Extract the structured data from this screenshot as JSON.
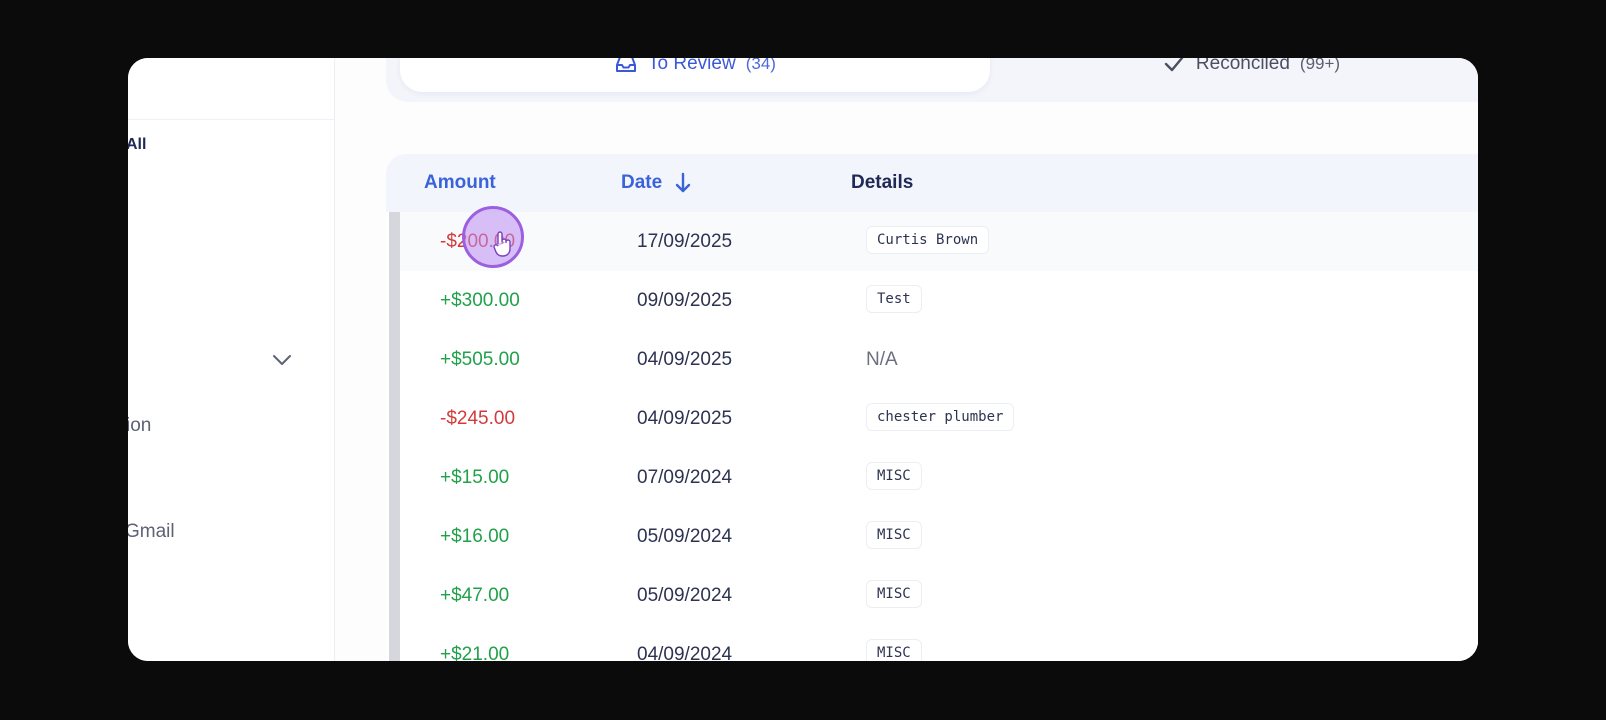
{
  "sidebar": {
    "all_label": "All",
    "item_ion": "ion",
    "item_gmail": "Gmail"
  },
  "tabs": {
    "review": {
      "label": "To Review",
      "count": "(34)"
    },
    "reconciled": {
      "label": "Reconciled",
      "count": "(99+)"
    }
  },
  "table": {
    "headers": {
      "amount": "Amount",
      "date": "Date",
      "details": "Details"
    },
    "rows": [
      {
        "amount": "-$200.00",
        "date": "17/09/2025",
        "details": "Curtis Brown",
        "sign": "neg"
      },
      {
        "amount": "+$300.00",
        "date": "09/09/2025",
        "details": "Test",
        "sign": "pos"
      },
      {
        "amount": "+$505.00",
        "date": "04/09/2025",
        "details": "N/A",
        "sign": "pos"
      },
      {
        "amount": "-$245.00",
        "date": "04/09/2025",
        "details": "chester plumber",
        "sign": "neg"
      },
      {
        "amount": "+$15.00",
        "date": "07/09/2024",
        "details": "MISC",
        "sign": "pos"
      },
      {
        "amount": "+$16.00",
        "date": "05/09/2024",
        "details": "MISC",
        "sign": "pos"
      },
      {
        "amount": "+$47.00",
        "date": "05/09/2024",
        "details": "MISC",
        "sign": "pos"
      },
      {
        "amount": "+$21.00",
        "date": "04/09/2024",
        "details": "MISC",
        "sign": "pos"
      }
    ]
  },
  "colors": {
    "accent": "#3b63d9",
    "negative": "#d23b3b",
    "positive": "#20a14a",
    "cursor": "#9b5fe0"
  },
  "icons": {
    "review_tab": "inbox-icon",
    "reconciled_tab": "check-icon",
    "sort": "arrow-down-icon",
    "sidebar_expand": "chevron-down-icon"
  }
}
